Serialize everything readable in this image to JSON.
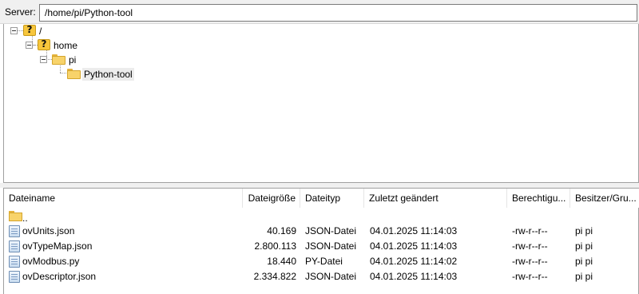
{
  "pathbar": {
    "label": "Server:",
    "path": "/home/pi/Python-tool"
  },
  "tree": {
    "nodes": [
      {
        "label": "/",
        "icon": "question-icon"
      },
      {
        "label": "home",
        "icon": "question-icon"
      },
      {
        "label": "pi",
        "icon": "folder-icon"
      },
      {
        "label": "Python-tool",
        "icon": "folder-icon",
        "selected": true
      }
    ]
  },
  "list": {
    "sort_indicator": "chevron-down-icon",
    "columns": {
      "name": "Dateiname",
      "size": "Dateigröße",
      "type": "Dateityp",
      "modified": "Zuletzt geändert",
      "perms": "Berechtigu...",
      "owner": "Besitzer/Gru..."
    },
    "rows": [
      {
        "icon": "folder-icon",
        "name": "..",
        "size": "",
        "type": "",
        "modified": "",
        "perms": "",
        "owner": ""
      },
      {
        "icon": "file-icon",
        "name": "ovUnits.json",
        "size": "40.169",
        "type": "JSON-Datei",
        "modified": "04.01.2025 11:14:03",
        "perms": "-rw-r--r--",
        "owner": "pi pi"
      },
      {
        "icon": "file-icon",
        "name": "ovTypeMap.json",
        "size": "2.800.113",
        "type": "JSON-Datei",
        "modified": "04.01.2025 11:14:03",
        "perms": "-rw-r--r--",
        "owner": "pi pi"
      },
      {
        "icon": "file-icon",
        "name": "ovModbus.py",
        "size": "18.440",
        "type": "PY-Datei",
        "modified": "04.01.2025 11:14:02",
        "perms": "-rw-r--r--",
        "owner": "pi pi"
      },
      {
        "icon": "file-icon",
        "name": "ovDescriptor.json",
        "size": "2.334.822",
        "type": "JSON-Datei",
        "modified": "04.01.2025 11:14:03",
        "perms": "-rw-r--r--",
        "owner": "pi pi"
      }
    ]
  }
}
